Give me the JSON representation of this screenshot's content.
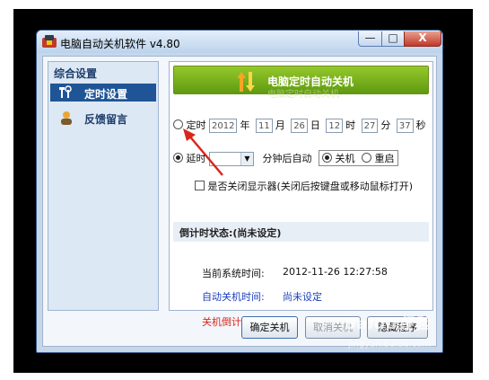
{
  "window": {
    "title": "电脑自动关机软件 v4.80",
    "min_glyph": "—",
    "max_glyph": "□",
    "close_glyph": "X"
  },
  "sidebar": {
    "header": "综合设置",
    "items": [
      {
        "label": "定时设置",
        "active": true
      },
      {
        "label": "反馈留言",
        "active": false
      }
    ]
  },
  "banner": {
    "title": "电脑定时自动关机",
    "reflection": "电脑定时自动关机"
  },
  "scheduled": {
    "label": "定时",
    "year": "2012",
    "year_unit": "年",
    "month": "11",
    "month_unit": "月",
    "day": "26",
    "day_unit": "日",
    "hour": "12",
    "hour_unit": "时",
    "minute": "27",
    "minute_unit": "分",
    "second": "37",
    "second_unit": "秒",
    "selected": false
  },
  "delay": {
    "label": "延时",
    "suffix": "分钟后自动",
    "selected": true,
    "mode_shutdown": "关机",
    "mode_restart": "重启",
    "shutdown_selected": true
  },
  "monitor_option": {
    "label": "是否关闭显示器(关闭后按键盘或移动鼠标打开)",
    "checked": false
  },
  "countdown_status": {
    "label": "倒计时状态:",
    "value": "(尚未设定)"
  },
  "info": {
    "system_time_label": "当前系统时间:",
    "system_time_value": "2012-11-26 12:27:58",
    "auto_time_label": "自动关机时间:",
    "auto_time_value": "尚未设定",
    "countdown_label": "关机倒计时间:"
  },
  "buttons": {
    "confirm": "确定关机",
    "cancel": "取消关机",
    "hide": "隐藏程序"
  },
  "watermark": {
    "text": "Baidu经验",
    "sub": "jingyan.baidu.com"
  },
  "colors": {
    "accent_blue": "#1f5596",
    "banner_green": "#6fae15",
    "info_blue": "#1b3fbd",
    "info_red": "#d9261c",
    "annotation_arrow": "#d9261c"
  }
}
